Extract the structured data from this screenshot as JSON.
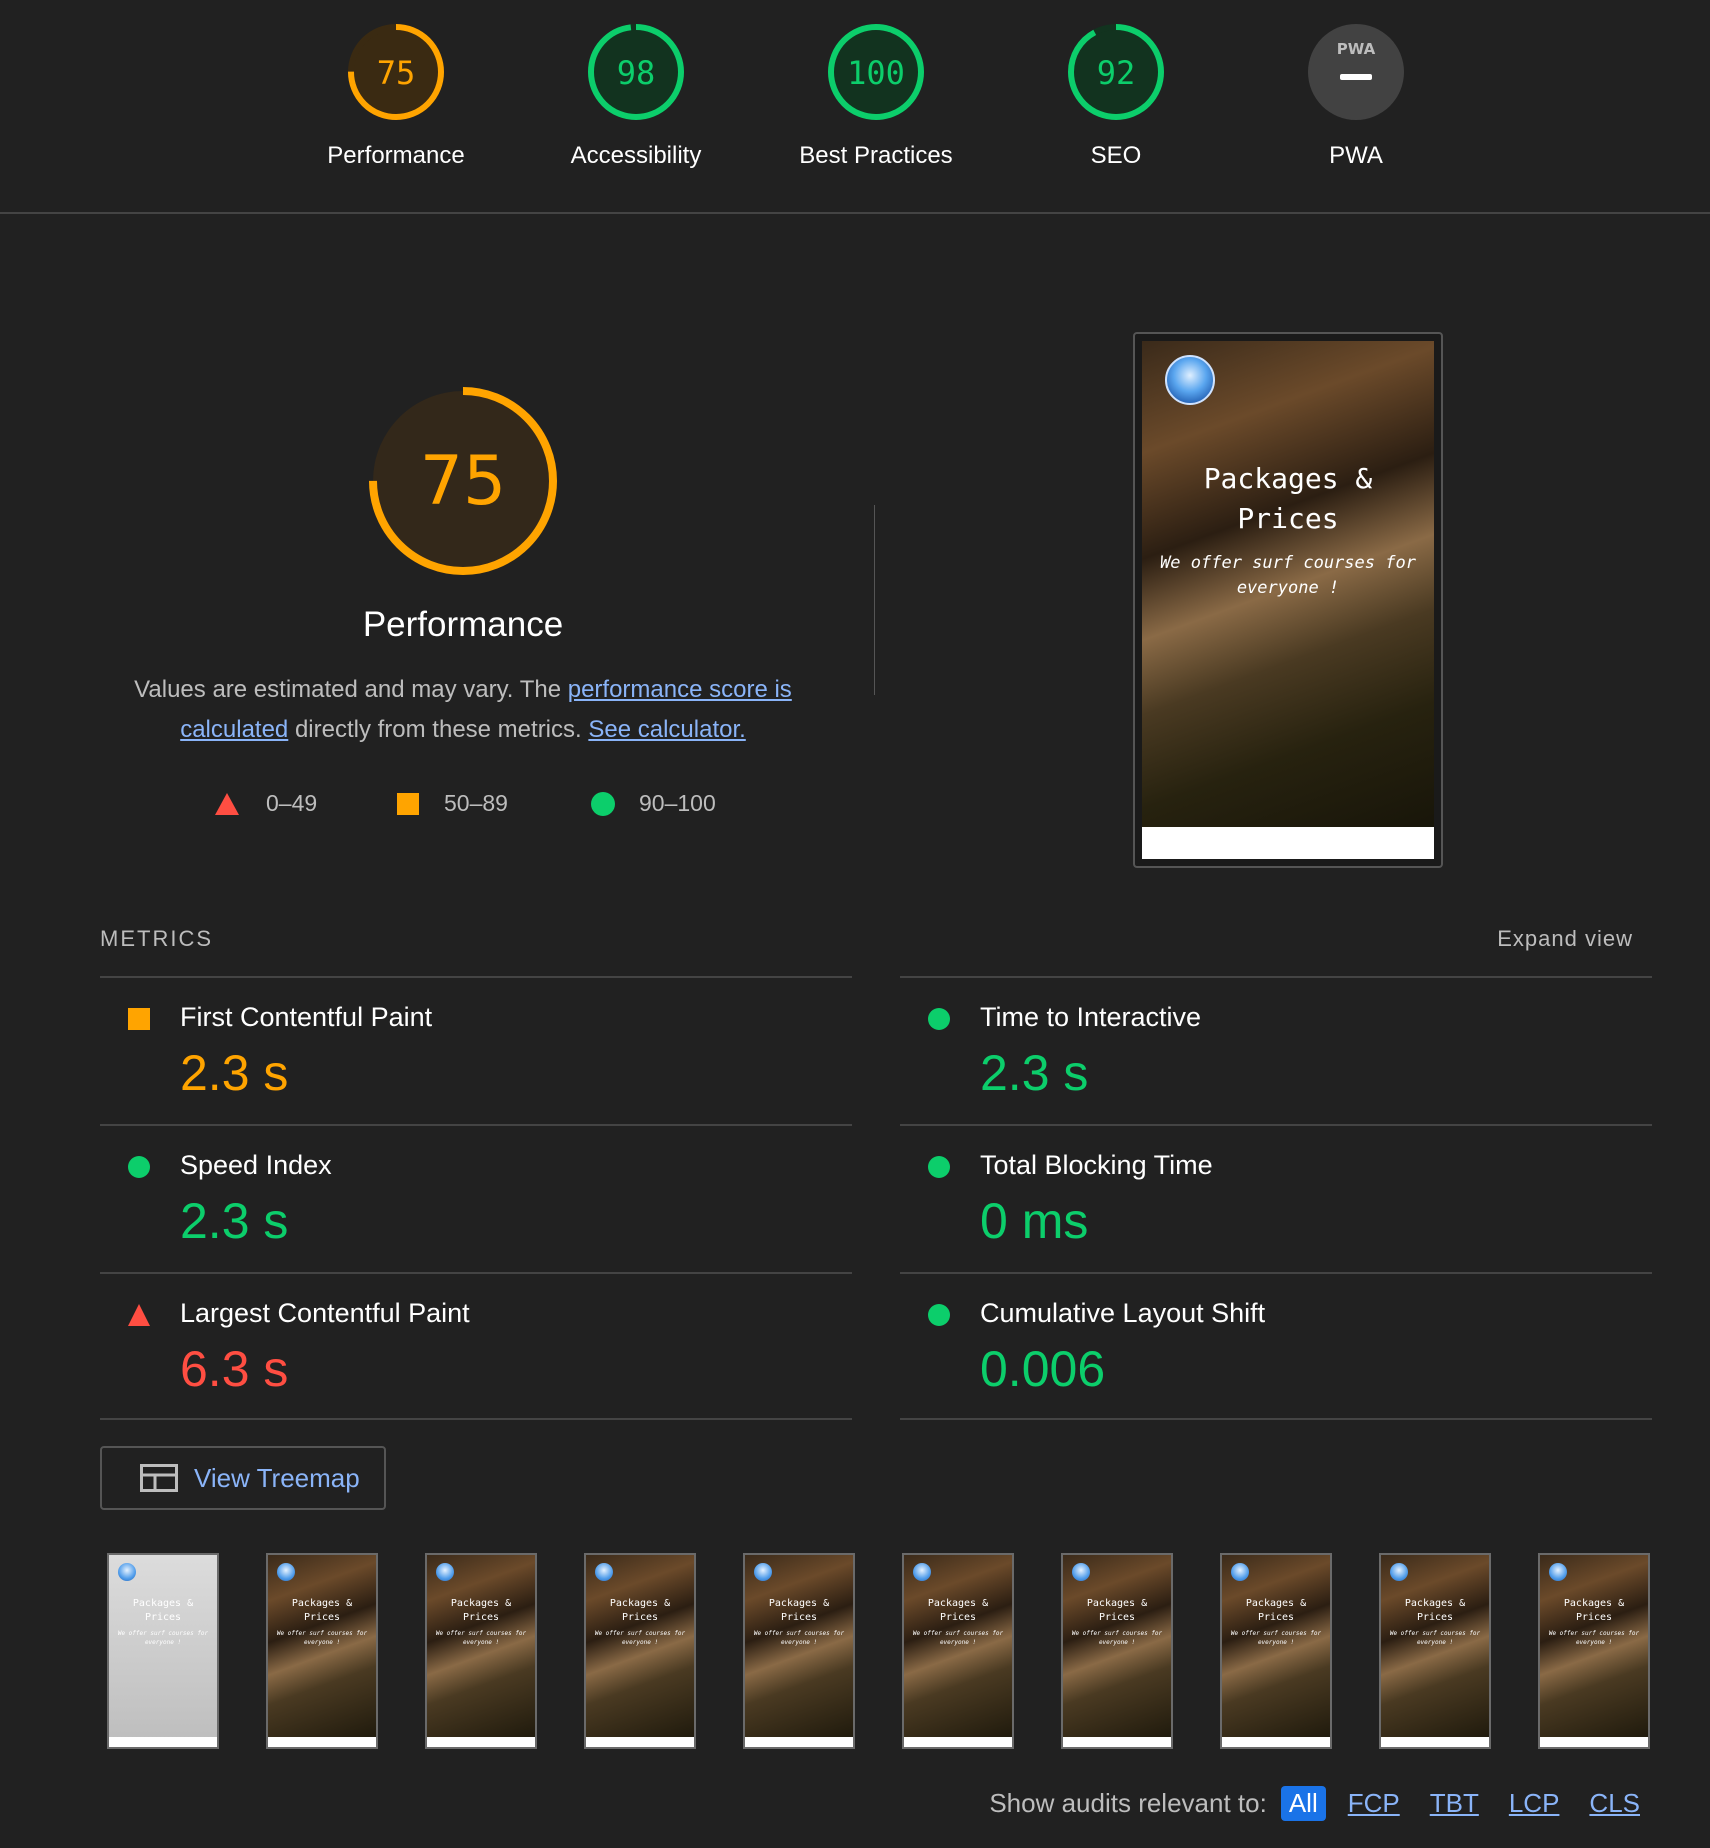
{
  "categories": [
    {
      "score": "75",
      "label": "Performance",
      "color": "#ffa400",
      "fraction": 0.75
    },
    {
      "score": "98",
      "label": "Accessibility",
      "color": "#0cce6b",
      "fraction": 0.98
    },
    {
      "score": "100",
      "label": "Best Practices",
      "color": "#0cce6b",
      "fraction": 1.0
    },
    {
      "score": "92",
      "label": "SEO",
      "color": "#0cce6b",
      "fraction": 0.92
    },
    {
      "score": "PWA",
      "label": "PWA",
      "color": "#424242",
      "fraction": 0
    }
  ],
  "performance": {
    "score": "75",
    "fraction": 0.75,
    "title": "Performance",
    "desc_1": "Values are estimated and may vary. The ",
    "link_1": "performance score is calculated",
    "desc_2": " directly from these metrics. ",
    "link_2": "See calculator."
  },
  "legend": [
    {
      "range": "0–49",
      "icon": "triangle",
      "color": "#ff4e42"
    },
    {
      "range": "50–89",
      "icon": "square",
      "color": "#ffa400"
    },
    {
      "range": "90–100",
      "icon": "circle",
      "color": "#0cce6b"
    }
  ],
  "screenshot": {
    "heading_line1": "Packages &",
    "heading_line2": "Prices",
    "sub_line1": "We offer surf courses for",
    "sub_line2": "everyone !"
  },
  "metrics_header": "METRICS",
  "expand_view": "Expand view",
  "metrics": [
    {
      "title": "First Contentful Paint",
      "value": "2.3 s",
      "status": "average"
    },
    {
      "title": "Time to Interactive",
      "value": "2.3 s",
      "status": "pass"
    },
    {
      "title": "Speed Index",
      "value": "2.3 s",
      "status": "pass"
    },
    {
      "title": "Total Blocking Time",
      "value": "0 ms",
      "status": "pass"
    },
    {
      "title": "Largest Contentful Paint",
      "value": "6.3 s",
      "status": "fail"
    },
    {
      "title": "Cumulative Layout Shift",
      "value": "0.006",
      "status": "pass"
    }
  ],
  "treemap_label": "View Treemap",
  "filmstrip_count": 10,
  "filter": {
    "label": "Show audits relevant to:",
    "options": [
      "All",
      "FCP",
      "TBT",
      "LCP",
      "CLS"
    ],
    "active": "All"
  }
}
